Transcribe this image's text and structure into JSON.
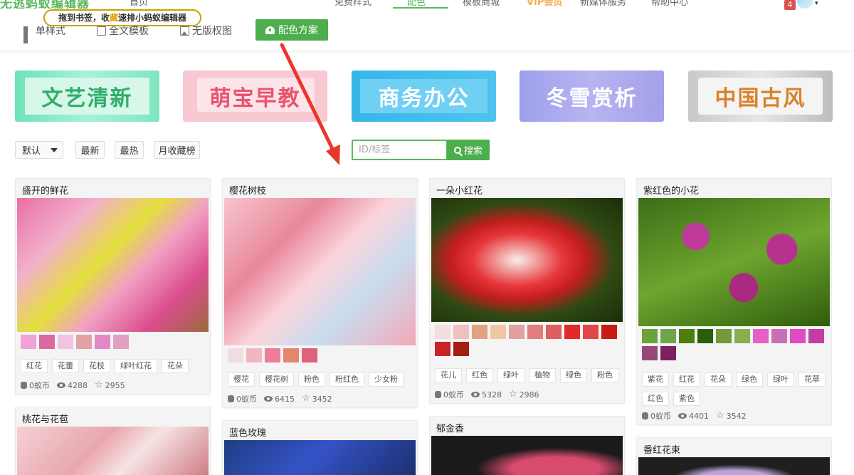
{
  "topnav": {
    "brand": "无逃蚂蚁编辑器",
    "items": [
      "首页",
      "免费样式",
      "配色",
      "模板商城",
      "VIP会员",
      "新媒体服务",
      "帮助中心"
    ],
    "notification_count": "4"
  },
  "bookmark_tip": {
    "before": "拖到书签，收",
    "highlight": "藏",
    "after": "速排小蚂蚁编辑器"
  },
  "tabs": [
    {
      "label": "单样式",
      "icon": "grid-icon"
    },
    {
      "label": "全文模板",
      "icon": "document-icon"
    },
    {
      "label": "无版权图",
      "icon": "image-icon"
    }
  ],
  "scheme_button": {
    "label": "配色方案",
    "icon": "dashboard-icon"
  },
  "categories": [
    {
      "label": "文艺清新"
    },
    {
      "label": "萌宝早教"
    },
    {
      "label": "商务办公"
    },
    {
      "label": "冬雪赏析"
    },
    {
      "label": "中国古风"
    }
  ],
  "sort": {
    "selected": "默认",
    "buttons": [
      "最新",
      "最热",
      "月收藏榜"
    ]
  },
  "search": {
    "placeholder": "ID/标签",
    "button": "搜索"
  },
  "cards": [
    {
      "title": "盛开的鲜花",
      "swatches": [
        "#f0a3d6",
        "#dd69a2",
        "#f2c3e0",
        "#e3a1a5",
        "#e289c5",
        "#e29fc3"
      ],
      "tags": [
        "红花",
        "花蕾",
        "花枝",
        "绿叶红花",
        "花朵"
      ],
      "coins": "0蚁币",
      "views": "4288",
      "stars": "2955"
    },
    {
      "title": "樱花树枝",
      "swatches": [
        "#f0dde1",
        "#f0b7c0",
        "#ee7e98",
        "#e3866b",
        "#e0627a"
      ],
      "tags": [
        "樱花",
        "樱花树",
        "粉色",
        "粉红色",
        "少女粉"
      ],
      "coins": "0蚁币",
      "views": "6415",
      "stars": "3452"
    },
    {
      "title": "一朵小红花",
      "swatches": [
        "#f2dedf",
        "#f0bfc0",
        "#e2a17f",
        "#f0c6a2",
        "#e0a1a2",
        "#e17e7e",
        "#de5f5f",
        "#e12a2a",
        "#e14746",
        "#c61c14",
        "#c92325",
        "#a31f14"
      ],
      "tags": [
        "花儿",
        "红色",
        "绿叶",
        "植物",
        "绿色",
        "粉色"
      ],
      "coins": "0蚁币",
      "views": "5328",
      "stars": "2986"
    },
    {
      "title": "紫红色的小花",
      "swatches": [
        "#6aa338",
        "#70a64b",
        "#4e7e0e",
        "#2b5e0a",
        "#749b3a",
        "#8aad4f",
        "#e461c8",
        "#c870b6",
        "#e04ac3",
        "#c43da3",
        "#974876",
        "#7f2060"
      ],
      "tags": [
        "紫花",
        "红花",
        "花朵",
        "绿色",
        "绿叶",
        "花草",
        "红色",
        "紫色"
      ],
      "coins": "0蚁币",
      "views": "4401",
      "stars": "3542"
    },
    {
      "title": "桃花与花苞"
    },
    {
      "title": "蓝色玫瑰"
    },
    {
      "title": "郁金香"
    },
    {
      "title": "番红花束"
    }
  ],
  "colors": {
    "accent": "#4cae4c",
    "arrow": "#e8382c"
  }
}
